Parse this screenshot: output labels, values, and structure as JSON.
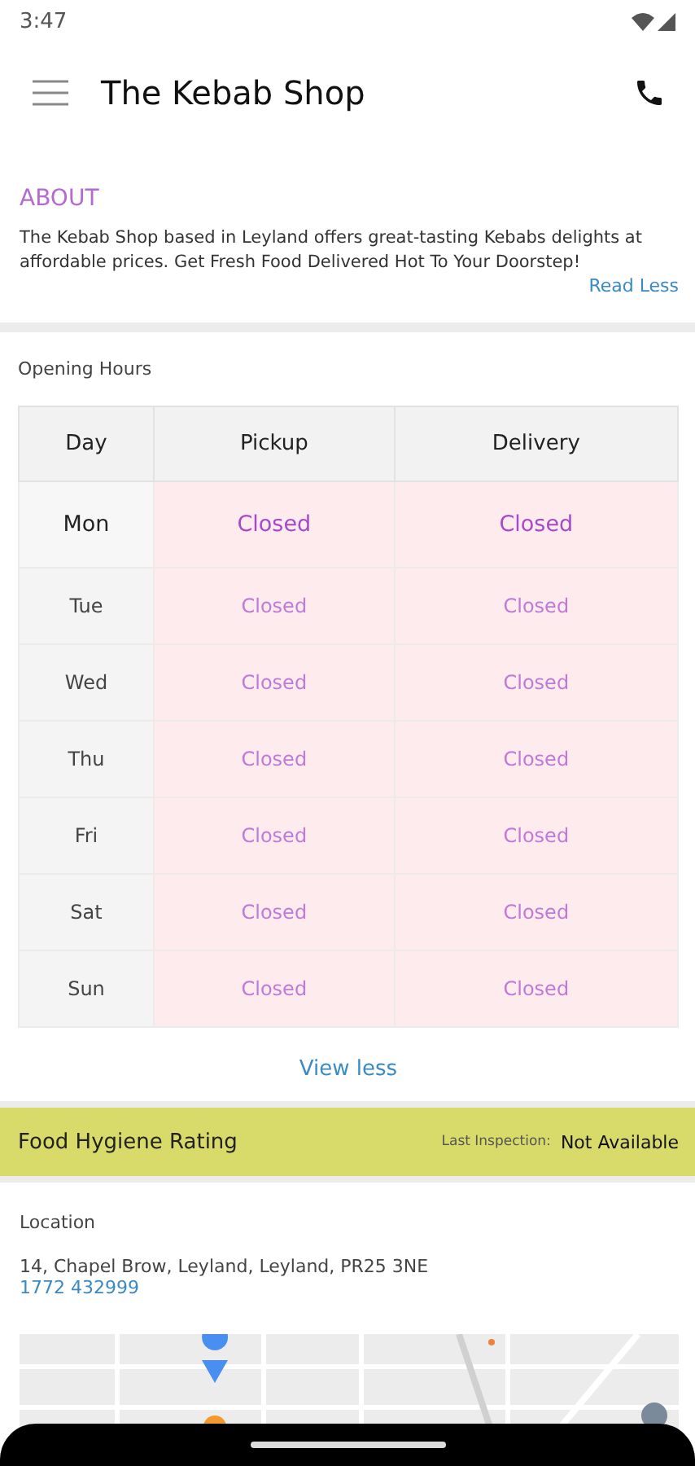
{
  "status_bar": {
    "time": "3:47"
  },
  "app_bar": {
    "title": "The Kebab Shop"
  },
  "about": {
    "heading": "ABOUT",
    "text": "The Kebab Shop based in Leyland offers great-tasting Kebabs delights at affordable prices. Get Fresh Food Delivered Hot To Your Doorstep!",
    "toggle": "Read Less"
  },
  "opening_hours": {
    "title": "Opening Hours",
    "columns": [
      "Day",
      "Pickup",
      "Delivery"
    ],
    "rows": [
      {
        "day": "Mon",
        "pickup": "Closed",
        "delivery": "Closed",
        "selected": true
      },
      {
        "day": "Tue",
        "pickup": "Closed",
        "delivery": "Closed",
        "selected": false
      },
      {
        "day": "Wed",
        "pickup": "Closed",
        "delivery": "Closed",
        "selected": false
      },
      {
        "day": "Thu",
        "pickup": "Closed",
        "delivery": "Closed",
        "selected": false
      },
      {
        "day": "Fri",
        "pickup": "Closed",
        "delivery": "Closed",
        "selected": false
      },
      {
        "day": "Sat",
        "pickup": "Closed",
        "delivery": "Closed",
        "selected": false
      },
      {
        "day": "Sun",
        "pickup": "Closed",
        "delivery": "Closed",
        "selected": false
      }
    ],
    "toggle": "View less"
  },
  "hygiene": {
    "title": "Food Hygiene Rating",
    "label": "Last Inspection:",
    "value": "Not Available"
  },
  "location": {
    "title": "Location",
    "address": "14, Chapel Brow, Leyland, Leyland, PR25 3NE",
    "phone": "1772 432999"
  }
}
